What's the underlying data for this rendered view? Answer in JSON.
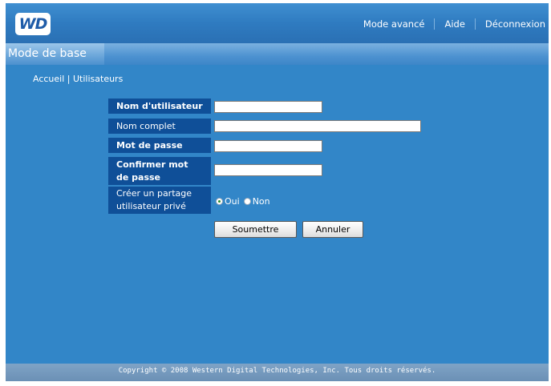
{
  "header": {
    "logo_text": "WD",
    "nav": {
      "advanced": "Mode avancé",
      "help": "Aide",
      "logout": "Déconnexion"
    }
  },
  "mode_tab": "Mode de base",
  "breadcrumb": {
    "home": "Accueil",
    "separator": "|",
    "current": "Utilisateurs"
  },
  "form": {
    "username_label": "Nom d'utilisateur",
    "username_value": "",
    "fullname_label": "Nom complet",
    "fullname_value": "",
    "password_label": "Mot de passe",
    "password_value": "",
    "confirm_label_line1": "Confirmer mot",
    "confirm_label_line2": "de passe",
    "confirm_value": "",
    "share_label_line1": "Créer un partage",
    "share_label_line2": "utilisateur privé",
    "share_options": [
      "Oui",
      "Non"
    ],
    "share_selected": "Oui",
    "submit_label": "Soumettre",
    "cancel_label": "Annuler"
  },
  "footer": "Copyright © 2008 Western Digital Technologies, Inc. Tous droits réservés.",
  "colors": {
    "background": "#3286c8",
    "label_cell": "#0f4f98",
    "footer": "#7399bf",
    "radio_selected": "#2a8a2a"
  }
}
